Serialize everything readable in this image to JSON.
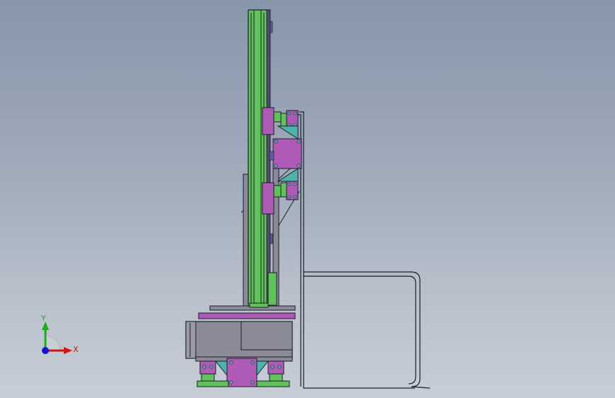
{
  "triad": {
    "y_label": "Y",
    "x_label": "X",
    "y_color": "#12b312",
    "x_color": "#d21414",
    "z_color": "#1414cc"
  },
  "colors": {
    "background_top": "#8896ab",
    "background_bottom": "#c6cdd6",
    "rail_green": "#5fc35a",
    "bracket_magenta": "#b05ab7",
    "block_teal": "#4fb3ad",
    "housing_gray": "#8a8b96",
    "edge_dark": "#1d1d2b"
  }
}
